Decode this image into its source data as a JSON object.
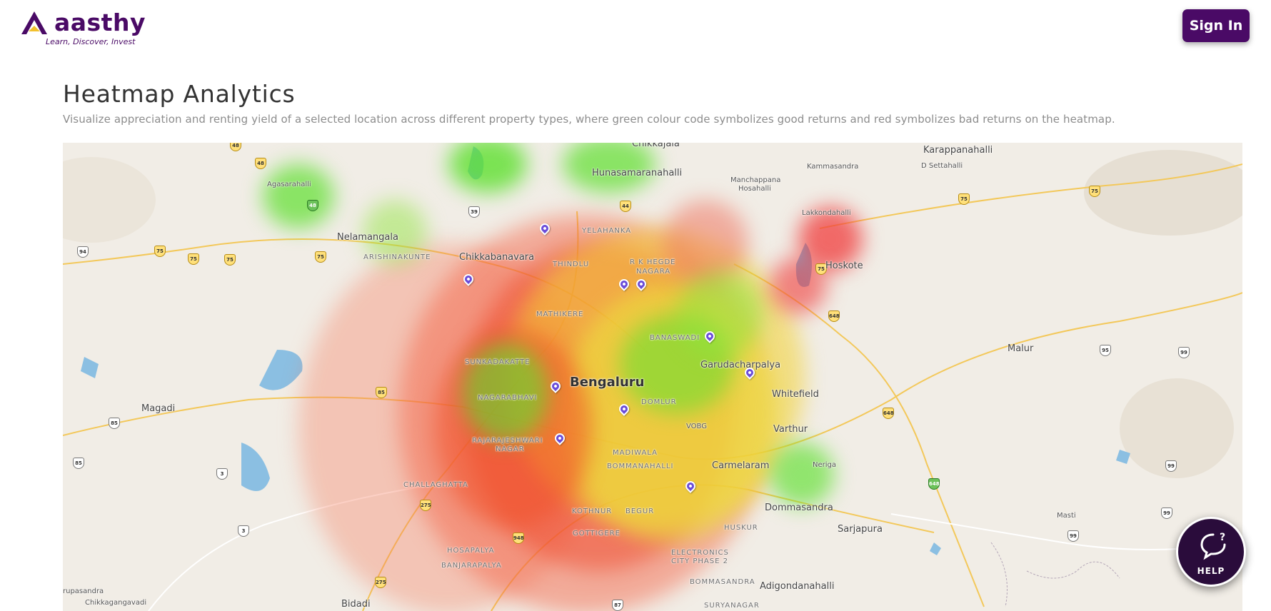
{
  "header": {
    "logo_text": "aasthy",
    "logo_tagline": "Learn, Discover, Invest",
    "signin_label": "Sign In"
  },
  "page": {
    "title": "Heatmap Analytics",
    "subtitle": "Visualize appreciation and renting yield of a selected location across different property types, where green colour code symbolizes good returns and red symbolizes bad returns on the heatmap."
  },
  "map": {
    "labels": {
      "chikkajala": "Chikkajala",
      "karappanahalli": "Karappanahalli",
      "kammasandra": "Kammasandra",
      "d_settahalli": "D Settahalli",
      "hunasamaranahalli": "Hunasamaranahalli",
      "manchappana": "Manchappana",
      "hosahalli": "Hosahalli",
      "agasarahalli": "Agasarahalli",
      "lakkondahalli": "Lakkondahalli",
      "yelahanka": "YELAHANKA",
      "nelamangala": "Nelamangala",
      "arishinakunte": "ARISHINAKUNTE",
      "chikkabanavara": "Chikkabanavara",
      "thindlu": "THINDLU",
      "rk_hegde": "R K HEGDE",
      "nagara": "NAGARA",
      "hoskote": "Hoskote",
      "mathikere": "MATHIKERE",
      "banaswadi": "BANASWADI",
      "malur": "Malur",
      "sunkadakatte": "SUNKADAKATTE",
      "garudacharpalya": "Garudacharpalya",
      "bengaluru": "Bengaluru",
      "whitefield": "Whitefield",
      "magadi": "Magadi",
      "nagarabhavi": "NAGARABHAVI",
      "domlur": "DOMLUR",
      "vobg": "VOBG",
      "varthur": "Varthur",
      "rajarajeshwari": "RAJARAJESHWARI",
      "rr_nagar": "NAGAR",
      "madiwala": "MADIWALA",
      "bommanahalli": "BOMMANAHALLI",
      "carmelaram": "Carmelaram",
      "neriga": "Neriga",
      "challaghatta": "CHALLAGHATTA",
      "dommasandra": "Dommasandra",
      "kothnur": "KOTHNUR",
      "begur": "BEGUR",
      "masti": "Masti",
      "huskur": "HUSKUR",
      "sarjapura": "Sarjapura",
      "gottigere": "GOTTIGERE",
      "hosapalya": "HOSAPALYA",
      "banjarapalya": "BANJARAPALYA",
      "electronics_city": "ELECTRONICS",
      "city_phase": "CITY PHASE 2",
      "bommasandra": "BOMMASANDRA",
      "adigondanahalli": "Adigondanahalli",
      "rupasandra": "rupasandra",
      "chikkagangavadi": "Chikkagangavadi",
      "bidadi": "Bidadi",
      "suryanagar": "SURYANAGAR"
    },
    "colors": {
      "good_return": "#5ee02e",
      "bad_return": "#f04a3a",
      "mid_return": "#f2e23a",
      "pin": "#6a4cd9"
    }
  },
  "help": {
    "label": "HELP"
  }
}
